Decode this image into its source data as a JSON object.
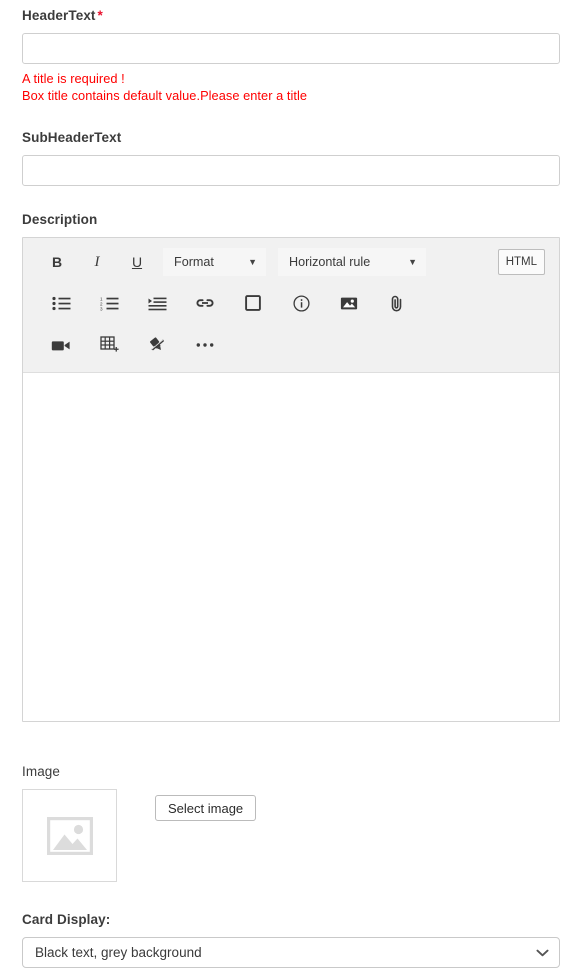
{
  "form": {
    "header_field": {
      "label": "HeaderText",
      "required_marker": "*",
      "value": "",
      "placeholder": "",
      "errors": [
        "A title is required !",
        "Box title contains default value.Please enter a title"
      ]
    },
    "subheader_field": {
      "label": "SubHeaderText",
      "value": "",
      "placeholder": ""
    },
    "description_field": {
      "label": "Description",
      "content": ""
    },
    "image_field": {
      "label": "Image",
      "select_button_label": "Select image",
      "thumbnail_icon": "image-placeholder-icon"
    },
    "card_display_field": {
      "label": "Card Display:",
      "selected_value": "Black text, grey background"
    }
  },
  "editor_toolbar": {
    "row1": {
      "bold_label": "B",
      "italic_label": "I",
      "underline_label": "U",
      "format_select": {
        "label": "Format",
        "caret": "▼"
      },
      "hrule_select": {
        "label": "Horizontal rule",
        "caret": "▼"
      },
      "html_button_label": "HTML"
    },
    "row2_icons": [
      "bullet-list-icon",
      "numbered-list-icon",
      "indent-icon",
      "link-icon",
      "box-icon",
      "info-icon",
      "image-icon",
      "attachment-icon"
    ],
    "row3_icons": [
      "video-icon",
      "insert-table-icon",
      "remove-format-icon",
      "more-options-icon"
    ]
  },
  "colors": {
    "error_text": "#ff0000",
    "required_star": "#e8112d",
    "toolbar_background": "#f1f1f1",
    "border": "#cfcfcf",
    "label_text": "#3c3c3c"
  }
}
